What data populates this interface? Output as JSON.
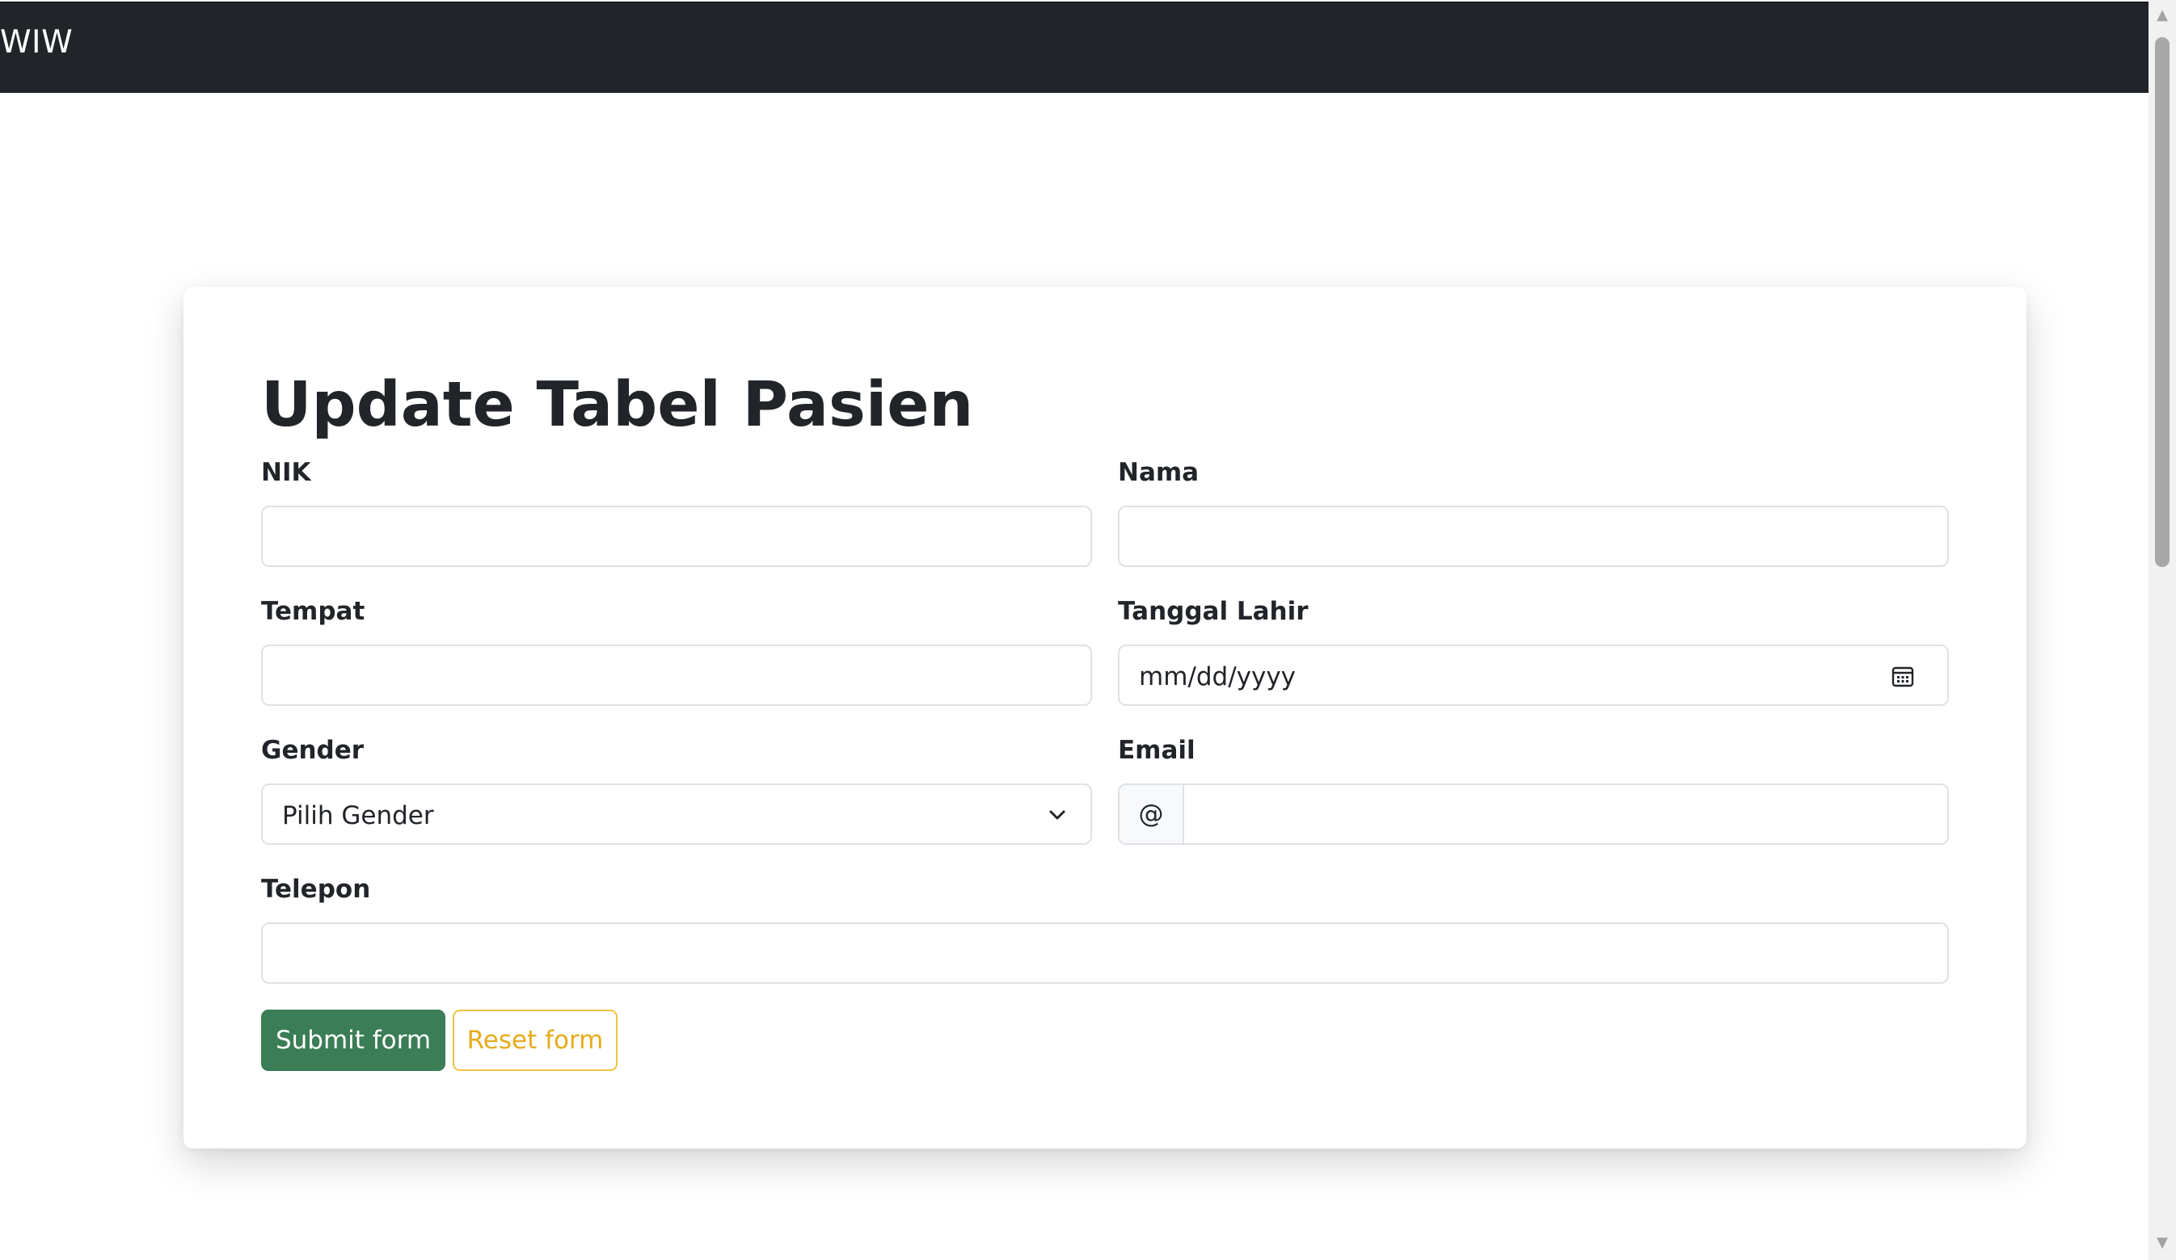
{
  "navbar": {
    "brand": "WIW"
  },
  "form": {
    "title": "Update Tabel Pasien",
    "fields": {
      "nik": {
        "label": "NIK",
        "value": ""
      },
      "nama": {
        "label": "Nama",
        "value": ""
      },
      "tempat": {
        "label": "Tempat",
        "value": ""
      },
      "tanggal_lahir": {
        "label": "Tanggal Lahir",
        "placeholder": "mm/dd/yyyy",
        "icon": "calendar-icon"
      },
      "gender": {
        "label": "Gender",
        "selected": "Pilih Gender",
        "icon": "chevron-down-icon"
      },
      "email": {
        "label": "Email",
        "addon": "@",
        "value": ""
      },
      "telepon": {
        "label": "Telepon",
        "value": ""
      }
    },
    "buttons": {
      "submit": "Submit form",
      "reset": "Reset form"
    }
  },
  "colors": {
    "navbar": "#212529",
    "submit": "#3a7d56",
    "reset": "#f0c240",
    "text": "#212529"
  },
  "scrollbar": {
    "up_icon": "▲",
    "down_icon": "▼"
  }
}
